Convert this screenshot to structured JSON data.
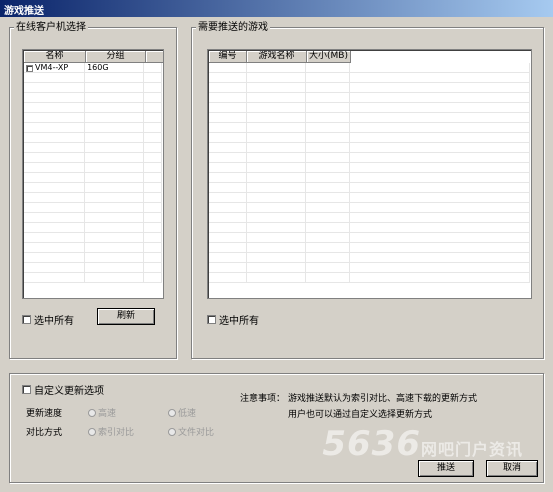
{
  "window": {
    "title": "游戏推送"
  },
  "left_group": {
    "title": "在线客户机选择",
    "columns": [
      "名称",
      "分组"
    ],
    "rows": [
      {
        "name": "VM4--XP",
        "group": "160G",
        "checked": false
      }
    ],
    "select_all_label": "选中所有",
    "refresh_label": "刷新"
  },
  "right_group": {
    "title": "需要推送的游戏",
    "columns": [
      "编号",
      "游戏名称",
      "大小(MB)"
    ],
    "select_all_label": "选中所有"
  },
  "options": {
    "custom_update_label": "自定义更新选项",
    "speed_label": "更新速度",
    "speed_options": [
      "高速",
      "低速"
    ],
    "compare_label": "对比方式",
    "compare_options": [
      "索引对比",
      "文件对比"
    ]
  },
  "notes": {
    "title": "注意事项：",
    "line1": "游戏推送默认为索引对比、高速下载的更新方式",
    "line2": "用户也可以通过自定义选择更新方式"
  },
  "buttons": {
    "push": "推送",
    "cancel": "取消"
  },
  "watermark": {
    "text": "5636",
    "sub": "网吧门户资讯"
  }
}
